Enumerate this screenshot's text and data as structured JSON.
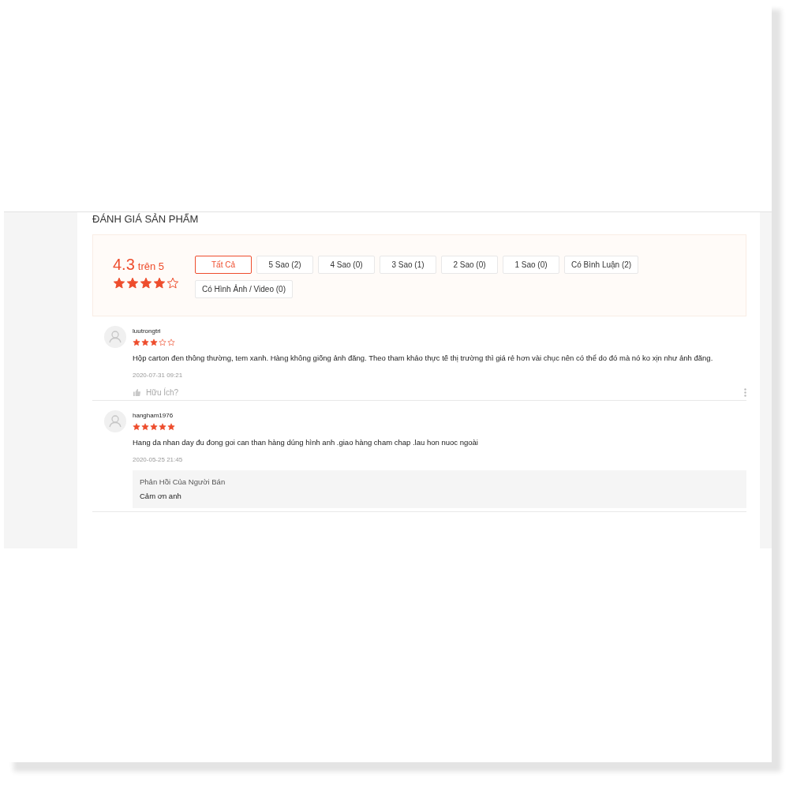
{
  "section_title": "ĐÁNH GIÁ SẢN PHẨM",
  "summary": {
    "score": "4.3",
    "out_of": "trên 5",
    "stars": 4
  },
  "filters": [
    {
      "label": "Tất Cả",
      "selected": true
    },
    {
      "label": "5 Sao (2)",
      "selected": false
    },
    {
      "label": "4 Sao (0)",
      "selected": false
    },
    {
      "label": "3 Sao (1)",
      "selected": false
    },
    {
      "label": "2 Sao (0)",
      "selected": false
    },
    {
      "label": "1 Sao (0)",
      "selected": false
    },
    {
      "label": "Có Bình Luận (2)",
      "selected": false
    },
    {
      "label": "Có Hình Ảnh / Video (0)",
      "selected": false
    }
  ],
  "reviews": [
    {
      "user": "luutrongtri",
      "stars": 3,
      "text": "Hộp carton đen thông thường, tem xanh. Hàng không giống ảnh đăng. Theo tham khảo thực tế thị trường thì giá rẻ hơn vài chục nên có thể do đó mà nó ko xịn như ảnh đăng.",
      "time": "2020-07-31 09:21",
      "helpful": "Hữu Ích?"
    },
    {
      "user": "hangham1976",
      "stars": 5,
      "text": "Hang da nhan day đu  đong goi can than hàng dúng hình anh .giao hàng cham chap .lau hon nuoc ngoài",
      "time": "2020-05-25 21:45",
      "seller_reply": {
        "title": "Phản Hồi Của Người Bán",
        "text": "Cảm ơn anh"
      }
    }
  ]
}
